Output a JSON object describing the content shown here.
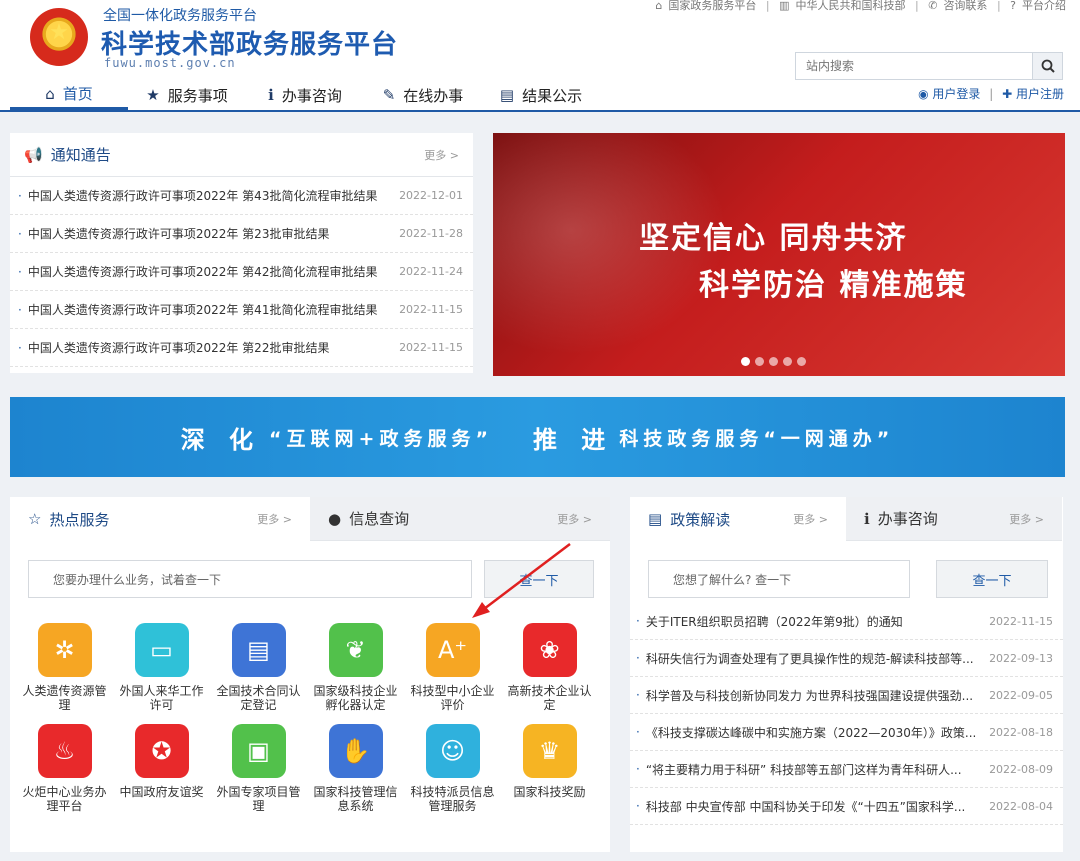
{
  "header": {
    "subtitle": "全国一体化政务服务平台",
    "title": "科学技术部政务服务平台",
    "domain": "fuwu.most.gov.cn",
    "top_links": [
      "国家政务服务平台",
      "中华人民共和国科技部",
      "咨询联系",
      "平台介绍"
    ],
    "search_placeholder": "站内搜索",
    "login": "用户登录",
    "register": "用户注册"
  },
  "nav": [
    {
      "label": "首页",
      "icon": "home-icon"
    },
    {
      "label": "服务事项",
      "icon": "star-icon"
    },
    {
      "label": "办事咨询",
      "icon": "info-icon"
    },
    {
      "label": "在线办事",
      "icon": "pencil-icon"
    },
    {
      "label": "结果公示",
      "icon": "document-icon"
    }
  ],
  "notice": {
    "title": "通知通告",
    "more": "更多 >",
    "items": [
      {
        "text": "中国人类遗传资源行政许可事项2022年 第43批简化流程审批结果",
        "date": "2022-12-01"
      },
      {
        "text": "中国人类遗传资源行政许可事项2022年 第23批审批结果",
        "date": "2022-11-28"
      },
      {
        "text": "中国人类遗传资源行政许可事项2022年 第42批简化流程审批结果",
        "date": "2022-11-24"
      },
      {
        "text": "中国人类遗传资源行政许可事项2022年 第41批简化流程审批结果",
        "date": "2022-11-15"
      },
      {
        "text": "中国人类遗传资源行政许可事项2022年 第22批审批结果",
        "date": "2022-11-15"
      }
    ]
  },
  "banner": {
    "line1": "坚定信心 同舟共济",
    "line2": "科学防治 精准施策",
    "slides": 5,
    "active_slide": 1
  },
  "slogan": {
    "part1": "深 化",
    "part2": "“互联网+政务服务”",
    "part3": "推 进",
    "part4": "科技政务服务“一网通办”"
  },
  "services": {
    "tab_active": "热点服务",
    "tab_active_more": "更多 >",
    "tab_other": "信息查询",
    "tab_other_more": "更多 >",
    "search_placeholder": "您要办理什么业务，试着查一下",
    "search_button": "查一下",
    "items": [
      {
        "label": "人类遗传资源管理",
        "icon": "molecule-icon",
        "color": "#f6a623"
      },
      {
        "label": "外国人来华工作许可",
        "icon": "id-card-icon",
        "color": "#2fc1d8"
      },
      {
        "label": "全国技术合同认定登记",
        "icon": "contract-icon",
        "color": "#3e74d6"
      },
      {
        "label": "国家级科技企业孵化器认定",
        "icon": "sprout-icon",
        "color": "#52c14b"
      },
      {
        "label": "科技型中小企业评价",
        "icon": "rating-icon",
        "color": "#f6a623"
      },
      {
        "label": "高新技术企业认定",
        "icon": "ribbon-icon",
        "color": "#e8292b"
      },
      {
        "label": "火炬中心业务办理平台",
        "icon": "torch-icon",
        "color": "#e8292b"
      },
      {
        "label": "中国政府友谊奖",
        "icon": "medal-icon",
        "color": "#e8292b"
      },
      {
        "label": "外国专家项目管理",
        "icon": "folder-icon",
        "color": "#52c14b"
      },
      {
        "label": "国家科技管理信息系统",
        "icon": "handshake-icon",
        "color": "#3e74d6"
      },
      {
        "label": "科技特派员信息管理服务",
        "icon": "specialist-icon",
        "color": "#2fb1dd"
      },
      {
        "label": "国家科技奖励",
        "icon": "trophy-icon",
        "color": "#f6b423"
      }
    ]
  },
  "policy": {
    "tab_active": "政策解读",
    "tab_active_more": "更多 >",
    "tab_other": "办事咨询",
    "tab_other_more": "更多 >",
    "search_placeholder": "您想了解什么? 查一下",
    "search_button": "查一下",
    "items": [
      {
        "text": "关于ITER组织职员招聘（2022年第9批）的通知",
        "date": "2022-11-15"
      },
      {
        "text": "科研失信行为调查处理有了更具操作性的规范-解读科技部等...",
        "date": "2022-09-13"
      },
      {
        "text": "科学普及与科技创新协同发力 为世界科技强国建设提供强劲...",
        "date": "2022-09-05"
      },
      {
        "text": "《科技支撑碳达峰碳中和实施方案（2022—2030年）》政策...",
        "date": "2022-08-18"
      },
      {
        "text": "“将主要精力用于科研” 科技部等五部门这样为青年科研人...",
        "date": "2022-08-09"
      },
      {
        "text": "科技部 中央宣传部 中国科协关于印发《“十四五”国家科学...",
        "date": "2022-08-04"
      }
    ]
  }
}
